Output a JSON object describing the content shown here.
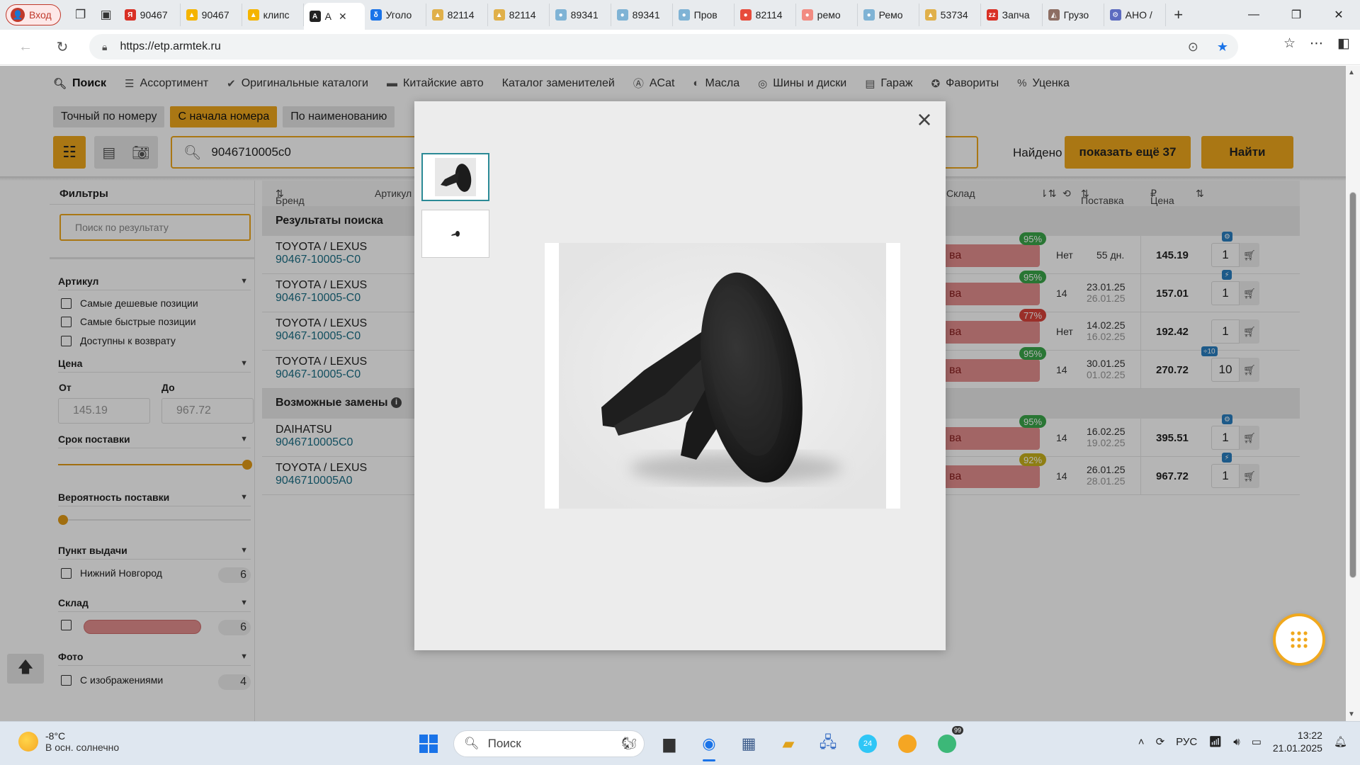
{
  "browser": {
    "profile_label": "Вход",
    "tabs": [
      {
        "label": "90467",
        "fav_color": "#d93025",
        "fav_glyph": "Я"
      },
      {
        "label": "90467",
        "fav_color": "#f5b400",
        "fav_glyph": "▲"
      },
      {
        "label": "клипс",
        "fav_color": "#f5b400",
        "fav_glyph": "▲"
      },
      {
        "label": "A",
        "fav_color": "#222222",
        "fav_glyph": "A",
        "active": true
      },
      {
        "label": "Уголо",
        "fav_color": "#1a73e8",
        "fav_glyph": "δ"
      },
      {
        "label": "82114",
        "fav_color": "#e0b04a",
        "fav_glyph": "▲"
      },
      {
        "label": "82114",
        "fav_color": "#e0b04a",
        "fav_glyph": "▲"
      },
      {
        "label": "89341",
        "fav_color": "#7fb3d5",
        "fav_glyph": "●"
      },
      {
        "label": "89341",
        "fav_color": "#7fb3d5",
        "fav_glyph": "●"
      },
      {
        "label": "Пров",
        "fav_color": "#7fb3d5",
        "fav_glyph": "●"
      },
      {
        "label": "82114",
        "fav_color": "#e74c3c",
        "fav_glyph": "●"
      },
      {
        "label": "ремо",
        "fav_color": "#f28b82",
        "fav_glyph": "●"
      },
      {
        "label": "Ремо",
        "fav_color": "#7fb3d5",
        "fav_glyph": "●"
      },
      {
        "label": "53734",
        "fav_color": "#e0b04a",
        "fav_glyph": "▲"
      },
      {
        "label": "Запча",
        "fav_color": "#d93025",
        "fav_glyph": "zz"
      },
      {
        "label": "Грузо",
        "fav_color": "#8d6e63",
        "fav_glyph": "◭"
      },
      {
        "label": "АНО /",
        "fav_color": "#5c6bc0",
        "fav_glyph": "⚙"
      }
    ],
    "url": "https://etp.armtek.ru"
  },
  "nav": {
    "items": [
      {
        "label": "Поиск",
        "icon": "search-icon",
        "glyph": "🔍︎",
        "active": true
      },
      {
        "label": "Ассортимент",
        "icon": "list-icon",
        "glyph": "☰"
      },
      {
        "label": "Оригинальные каталоги",
        "icon": "check-circle-icon",
        "glyph": "✔"
      },
      {
        "label": "Китайские авто",
        "icon": "card-icon",
        "glyph": "▬"
      },
      {
        "label": "Каталог заменителей",
        "icon": "",
        "glyph": ""
      },
      {
        "label": "ACat",
        "icon": "acat-icon",
        "glyph": "Ⓐ"
      },
      {
        "label": "Масла",
        "icon": "drop-icon",
        "glyph": "◐"
      },
      {
        "label": "Шины и диски",
        "icon": "tire-icon",
        "glyph": "◎"
      },
      {
        "label": "Гараж",
        "icon": "garage-icon",
        "glyph": "▤"
      },
      {
        "label": "Фавориты",
        "icon": "star-badge-icon",
        "glyph": "✪"
      },
      {
        "label": "Уценка",
        "icon": "percent-icon",
        "glyph": "%"
      }
    ]
  },
  "modes": [
    "Точный по номеру",
    "С начала номера",
    "По наименованию"
  ],
  "search": {
    "value": "9046710005c0",
    "found_label": "Найдено 6",
    "more_label": "показать ещё 37",
    "find_label": "Найти"
  },
  "filters": {
    "title": "Фильтры",
    "result_placeholder": "Поиск по результату",
    "article_section": "Артикул",
    "article_options": [
      "Самые дешевые позиции",
      "Самые быстрые позиции",
      "Доступны к возврату"
    ],
    "price_section": "Цена",
    "price_from_label": "От",
    "price_to_label": "До",
    "price_from": "145.19",
    "price_to": "967.72",
    "delivery_section": "Срок поставки",
    "probability_section": "Вероятность поставки",
    "pickup_section": "Пункт выдачи",
    "pickup_option": "Нижний Новгород",
    "pickup_count": "6",
    "warehouse_section": "Склад",
    "warehouse_count": "6",
    "photo_section": "Фото",
    "photo_option": "С изображениями",
    "photo_count": "4"
  },
  "table": {
    "headers": {
      "brand": "Бренд",
      "article": "Артикул",
      "warehouse": "Склад",
      "delivery": "Поставка",
      "price": "Цена"
    },
    "results_title": "Результаты поиска",
    "replacements_title": "Возможные замены",
    "results": [
      {
        "brand": "TOYOTA / LEXUS",
        "article": "90467-10005-C0",
        "stock": "ва",
        "pct": "95%",
        "pct_color": "#3aa64a",
        "qty": "Нет",
        "date1": "55 дн.",
        "date2": "",
        "price": "145.19",
        "order_qty": "1",
        "tag": "⚙"
      },
      {
        "brand": "TOYOTA / LEXUS",
        "article": "90467-10005-C0",
        "stock": "ва",
        "pct": "95%",
        "pct_color": "#3aa64a",
        "qty": "14",
        "date1": "23.01.25",
        "date2": "26.01.25",
        "price": "157.01",
        "order_qty": "1",
        "tag": "⚡"
      },
      {
        "brand": "TOYOTA / LEXUS",
        "article": "90467-10005-C0",
        "stock": "ва",
        "pct": "77%",
        "pct_color": "#d9433a",
        "qty": "Нет",
        "date1": "14.02.25",
        "date2": "16.02.25",
        "price": "192.42",
        "order_qty": "1",
        "tag": ""
      },
      {
        "brand": "TOYOTA / LEXUS",
        "article": "90467-10005-C0",
        "stock": "ва",
        "pct": "95%",
        "pct_color": "#3aa64a",
        "qty": "14",
        "date1": "30.01.25",
        "date2": "01.02.25",
        "price": "270.72",
        "order_qty": "10",
        "tag": "÷10"
      }
    ],
    "replacements": [
      {
        "brand": "DAIHATSU",
        "article": "9046710005C0",
        "stock": "ва",
        "pct": "95%",
        "pct_color": "#3aa64a",
        "qty": "14",
        "date1": "16.02.25",
        "date2": "19.02.25",
        "price": "395.51",
        "order_qty": "1",
        "tag": "⚙"
      },
      {
        "brand": "TOYOTA / LEXUS",
        "article": "9046710005A0",
        "stock": "ва",
        "pct": "92%",
        "pct_color": "#c9b21c",
        "qty": "14",
        "date1": "26.01.25",
        "date2": "28.01.25",
        "price": "967.72",
        "order_qty": "1",
        "tag": "⚡"
      }
    ]
  },
  "taskbar": {
    "temp": "-8°C",
    "weather": "В осн. солнечно",
    "search_label": "Поиск",
    "lang": "РУС",
    "time": "13:22",
    "date": "21.01.2025",
    "badge": "99",
    "app24": "24"
  }
}
